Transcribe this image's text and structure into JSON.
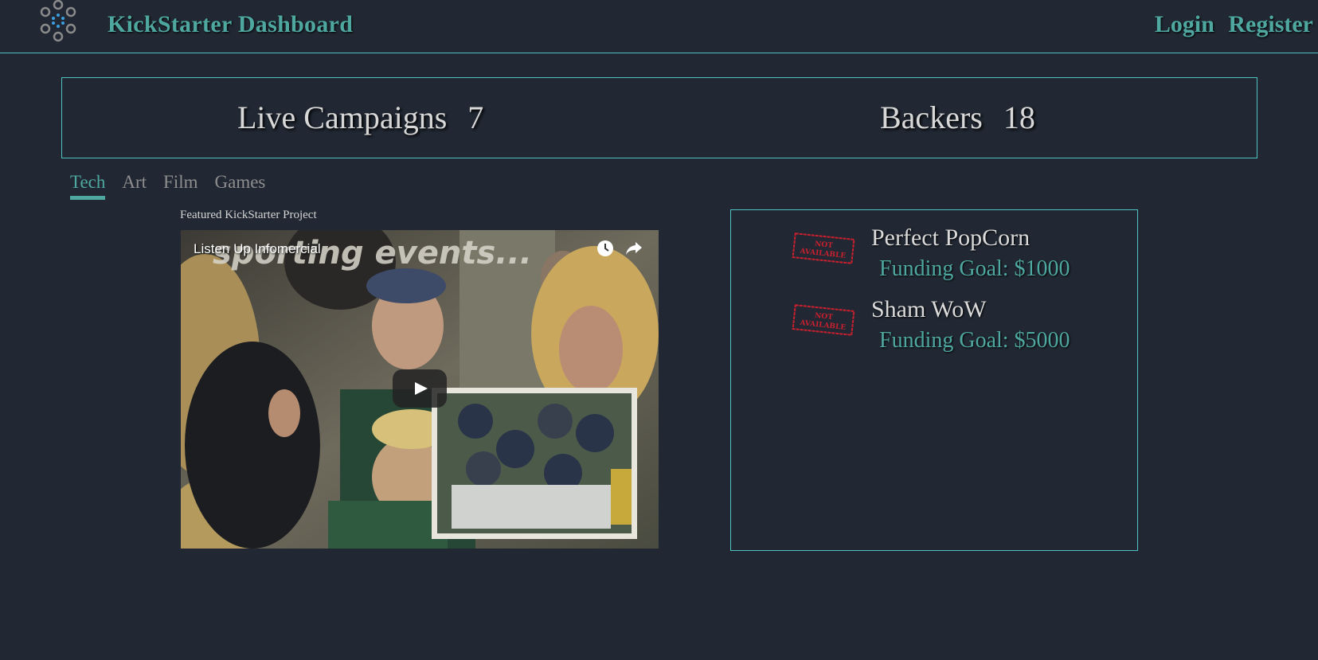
{
  "header": {
    "brand": "KickStarter Dashboard",
    "login": "Login",
    "register": "Register",
    "logo_icon": "dots-circle-logo-icon"
  },
  "stats": {
    "campaigns_label": "Live Campaigns",
    "campaigns_value": "7",
    "backers_label": "Backers",
    "backers_value": "18"
  },
  "tabs": [
    {
      "label": "Tech",
      "active": true
    },
    {
      "label": "Art",
      "active": false
    },
    {
      "label": "Film",
      "active": false
    },
    {
      "label": "Games",
      "active": false
    }
  ],
  "featured": {
    "label": "Featured KickStarter Project",
    "video_title": "Listen Up Infomercial",
    "video_caption": "sporting events..."
  },
  "projects": [
    {
      "name": "Perfect PopCorn",
      "goal": " Funding Goal: $1000",
      "badge": "NOT AVAILABLE"
    },
    {
      "name": "Sham WoW",
      "goal": " Funding Goal: $5000",
      "badge": "NOT AVAILABLE"
    }
  ],
  "colors": {
    "background": "#212833",
    "accent": "#4fa8a0",
    "border": "#4ec3c1",
    "stamp": "#c8202e"
  }
}
